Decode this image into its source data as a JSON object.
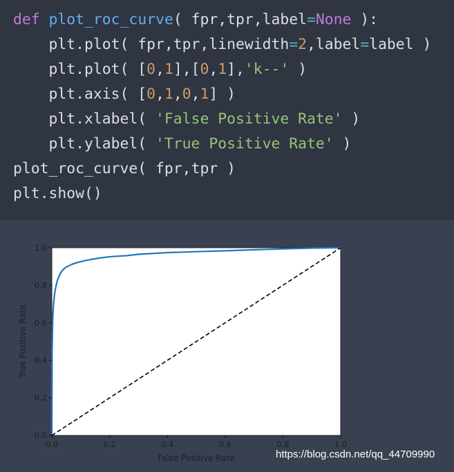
{
  "code_cell": {
    "lines": [
      {
        "indent": 0,
        "tokens": [
          [
            "def",
            "kw"
          ],
          [
            " ",
            ""
          ],
          [
            "plot_roc_curve",
            "fn"
          ],
          [
            "( fpr,tpr,label",
            ""
          ],
          [
            "=",
            "op"
          ],
          [
            "None",
            "const"
          ],
          [
            " ):",
            ""
          ]
        ]
      },
      {
        "indent": 1,
        "tokens": [
          [
            "plt.plot( fpr,tpr,linewidth",
            ""
          ],
          [
            "=",
            "op"
          ],
          [
            "2",
            "num"
          ],
          [
            ",label",
            ""
          ],
          [
            "=",
            "op"
          ],
          [
            "label )",
            ""
          ]
        ]
      },
      {
        "indent": 1,
        "tokens": [
          [
            "plt.plot( [",
            ""
          ],
          [
            "0",
            "num"
          ],
          [
            ",",
            ""
          ],
          [
            "1",
            "num"
          ],
          [
            "],[",
            ""
          ],
          [
            "0",
            "num"
          ],
          [
            ",",
            ""
          ],
          [
            "1",
            "num"
          ],
          [
            "],",
            ""
          ],
          [
            "'k--'",
            "str"
          ],
          [
            " )",
            ""
          ]
        ]
      },
      {
        "indent": 1,
        "tokens": [
          [
            "plt.axis( [",
            ""
          ],
          [
            "0",
            "num"
          ],
          [
            ",",
            ""
          ],
          [
            "1",
            "num"
          ],
          [
            ",",
            ""
          ],
          [
            "0",
            "num"
          ],
          [
            ",",
            ""
          ],
          [
            "1",
            "num"
          ],
          [
            "] )",
            ""
          ]
        ]
      },
      {
        "indent": 1,
        "tokens": [
          [
            "plt.xlabel( ",
            ""
          ],
          [
            "'False Positive Rate'",
            "str"
          ],
          [
            " )",
            ""
          ]
        ]
      },
      {
        "indent": 1,
        "tokens": [
          [
            "plt.ylabel( ",
            ""
          ],
          [
            "'True Positive Rate'",
            "str"
          ],
          [
            " )",
            ""
          ]
        ]
      },
      {
        "indent": 0,
        "tokens": [
          [
            "plot_roc_curve( fpr,tpr )",
            ""
          ]
        ]
      },
      {
        "indent": 0,
        "tokens": [
          [
            "plt.show()",
            ""
          ]
        ]
      }
    ]
  },
  "chart_data": {
    "type": "line",
    "xlabel": "False Positive Rate",
    "ylabel": "True Positive Rate",
    "xlim": [
      0,
      1
    ],
    "ylim": [
      0,
      1
    ],
    "xticks": [
      "0.0",
      "0.2",
      "0.4",
      "0.6",
      "0.8",
      "1.0"
    ],
    "yticks": [
      "0.0",
      "0.2",
      "0.4",
      "0.6",
      "0.8",
      "1.0"
    ],
    "grid": false,
    "series": [
      {
        "color": "#1f77b4",
        "style": "solid",
        "x": [
          0,
          0.001,
          0.003,
          0.006,
          0.01,
          0.015,
          0.02,
          0.03,
          0.04,
          0.05,
          0.07,
          0.09,
          0.12,
          0.16,
          0.2,
          0.26,
          0.3,
          0.4,
          0.5,
          0.6,
          0.7,
          0.8,
          0.9,
          1.0
        ],
        "y": [
          0,
          0.45,
          0.62,
          0.7,
          0.76,
          0.8,
          0.83,
          0.865,
          0.885,
          0.897,
          0.912,
          0.922,
          0.933,
          0.944,
          0.952,
          0.958,
          0.965,
          0.974,
          0.979,
          0.984,
          0.989,
          0.994,
          0.998,
          1.0
        ]
      },
      {
        "color": "#000000",
        "style": "dashed",
        "x": [
          0,
          1
        ],
        "y": [
          0,
          1
        ]
      }
    ]
  },
  "watermark": "https://blog.csdn.net/qq_44709990"
}
